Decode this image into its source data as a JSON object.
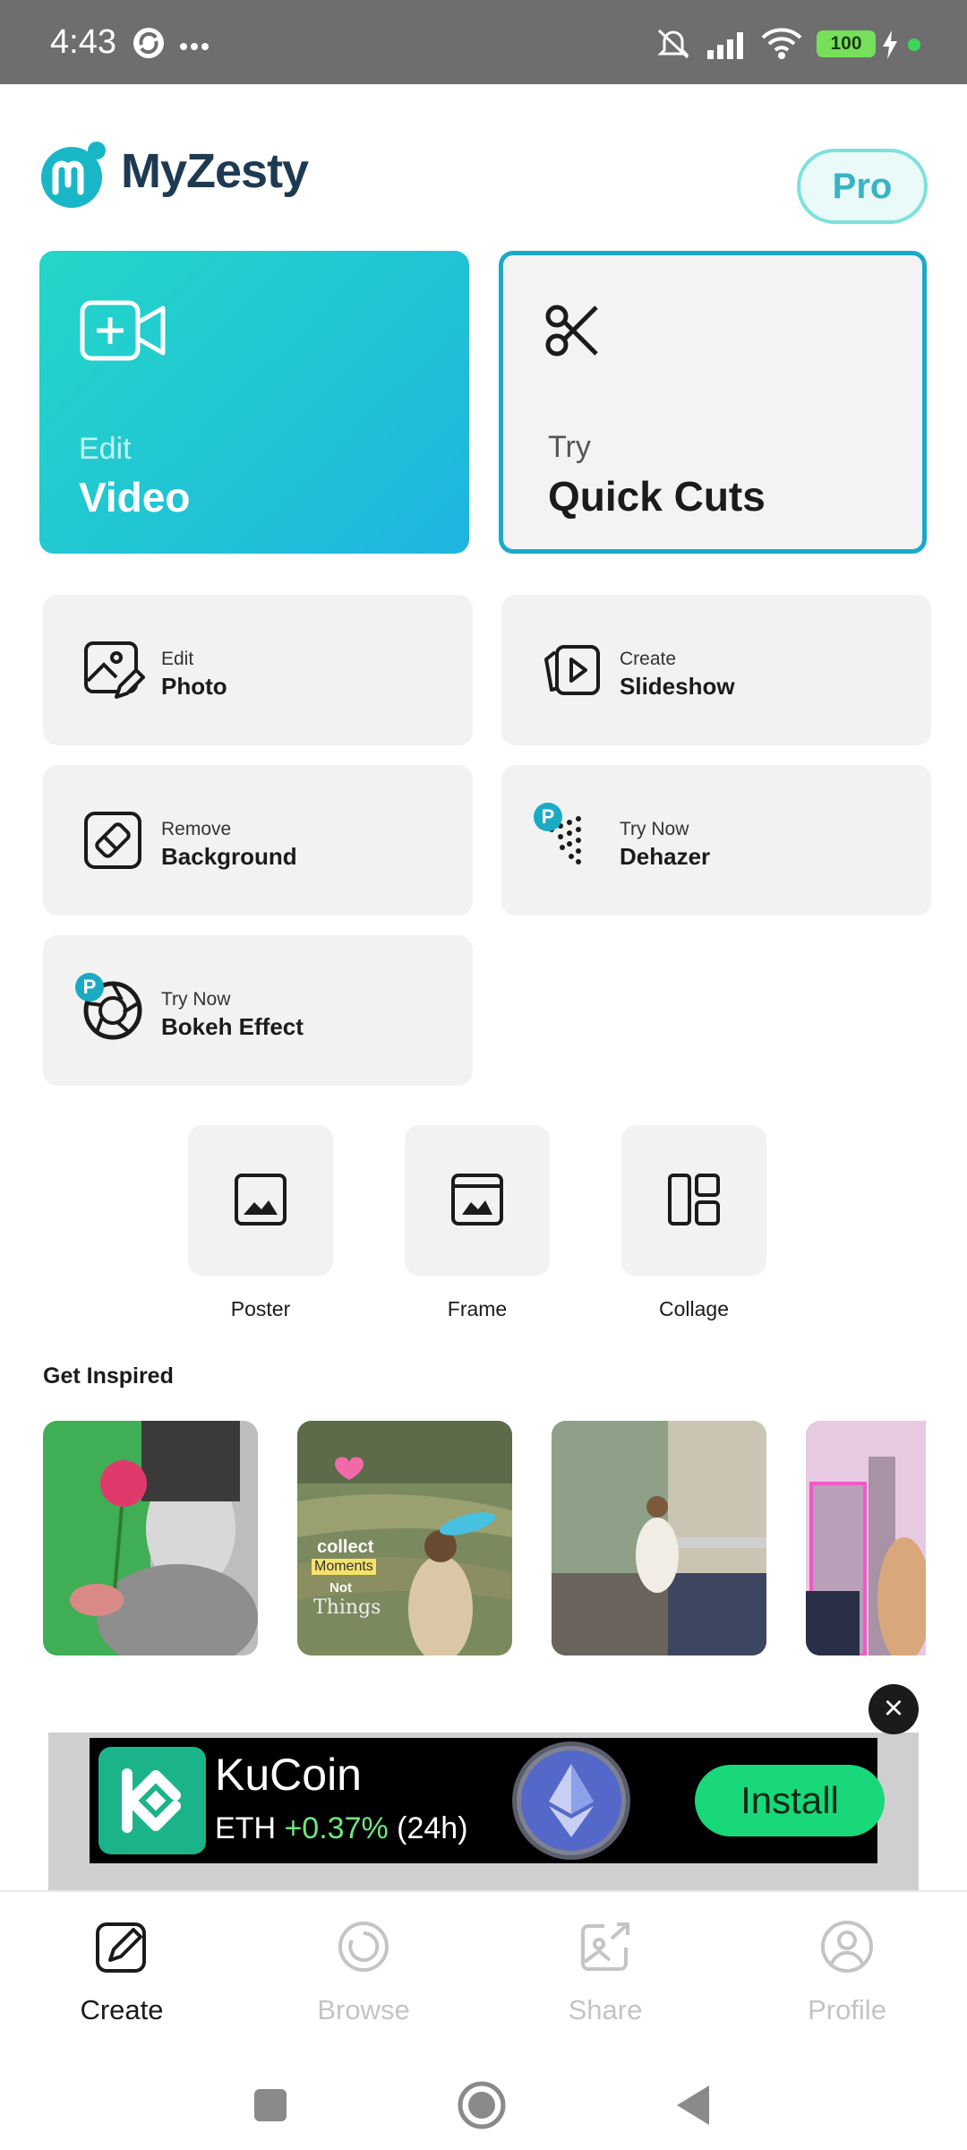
{
  "status_bar": {
    "time": "4:43",
    "battery": "100"
  },
  "header": {
    "app_name": "MyZesty",
    "pro_label": "Pro"
  },
  "big_cards": {
    "video": {
      "sub": "Edit",
      "title": "Video",
      "icon": "video-add-icon"
    },
    "cuts": {
      "sub": "Try",
      "title": "Quick Cuts",
      "icon": "scissors-icon"
    }
  },
  "tiles": [
    {
      "sub": "Edit",
      "title": "Photo",
      "icon": "photo-edit-icon"
    },
    {
      "sub": "Create",
      "title": "Slideshow",
      "icon": "slideshow-icon"
    },
    {
      "sub": "Remove",
      "title": "Background",
      "icon": "eraser-icon",
      "badge": "P"
    },
    {
      "sub": "Try Now",
      "title": "Dehazer",
      "icon": "dehaze-icon",
      "badge": "P"
    },
    {
      "sub": "Try Now",
      "title": "Bokeh Effect",
      "icon": "aperture-icon",
      "badge": "P"
    }
  ],
  "square_tools": [
    {
      "label": "Poster",
      "icon": "poster-icon"
    },
    {
      "label": "Frame",
      "icon": "frame-icon"
    },
    {
      "label": "Collage",
      "icon": "collage-icon"
    }
  ],
  "inspired": {
    "title": "Get Inspired",
    "thumb2_text": [
      "collect",
      "Moments",
      "Not",
      "Things"
    ]
  },
  "ad": {
    "title": "KuCoin",
    "sub_prefix": "ETH ",
    "sub_pct": "+0.37%",
    "sub_suffix": " (24h)",
    "install_label": "Install",
    "close_icon": "close-icon"
  },
  "bottom_nav": [
    {
      "label": "Create",
      "icon": "create-icon",
      "active": true
    },
    {
      "label": "Browse",
      "icon": "browse-icon",
      "active": false
    },
    {
      "label": "Share",
      "icon": "share-icon",
      "active": false
    },
    {
      "label": "Profile",
      "icon": "profile-icon",
      "active": false
    }
  ],
  "colors": {
    "accent": "#19aac9",
    "brand_dark": "#1d3a52",
    "video_gradient_start": "#23d7c7",
    "video_gradient_end": "#1fb4e0",
    "install_green": "#19d87a"
  }
}
